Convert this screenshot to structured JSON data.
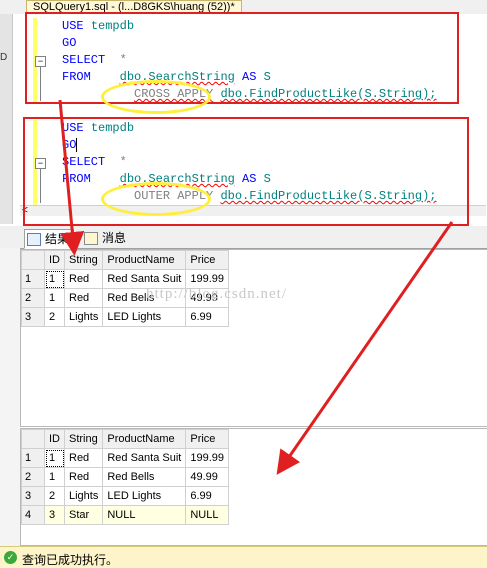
{
  "editor": {
    "tab_title": "SQLQuery1.sql - (l...D8GKS\\huang (52))*",
    "gutter_mark": "D",
    "block1": {
      "line1": {
        "kw": "USE",
        "id": "tempdb"
      },
      "line2": {
        "kw": "GO"
      },
      "line3": {
        "kw": "SELECT",
        "rest": "*"
      },
      "line4": {
        "kw": "FROM",
        "table": "dbo.SearchString",
        "as": "AS",
        "alias": "S"
      },
      "line5": {
        "apply": "CROSS APPLY",
        "func": "dbo.FindProductLike(S.String);"
      }
    },
    "block2": {
      "line1": {
        "kw": "USE",
        "id": "tempdb"
      },
      "line2": {
        "kw": "GO"
      },
      "line3": {
        "kw": "SELECT",
        "rest": "*"
      },
      "line4": {
        "kw": "FROM",
        "table": "dbo.SearchString",
        "as": "AS",
        "alias": "S"
      },
      "line5": {
        "apply": "OUTER APPLY",
        "func": "dbo.FindProductLike(S.String);"
      }
    },
    "scroll_mark": "<"
  },
  "results": {
    "tabs": [
      {
        "label": "结果",
        "icon": "grid-icon"
      },
      {
        "label": "消息",
        "icon": "message-icon"
      }
    ],
    "columns": [
      "",
      "ID",
      "String",
      "ProductName",
      "Price"
    ],
    "grid1": [
      [
        "1",
        "1",
        "Red",
        "Red Santa Suit",
        "199.99"
      ],
      [
        "2",
        "1",
        "Red",
        "Red Bells",
        "49.99"
      ],
      [
        "3",
        "2",
        "Lights",
        "LED Lights",
        "6.99"
      ]
    ],
    "grid2": [
      [
        "1",
        "1",
        "Red",
        "Red Santa Suit",
        "199.99"
      ],
      [
        "2",
        "1",
        "Red",
        "Red Bells",
        "49.99"
      ],
      [
        "3",
        "2",
        "Lights",
        "LED Lights",
        "6.99"
      ],
      [
        "4",
        "3",
        "Star",
        "NULL",
        "NULL"
      ]
    ]
  },
  "watermark": "http://blog.csdn.net/",
  "status": {
    "text": "查询已成功执行。",
    "icon": "success-check-icon"
  },
  "colors": {
    "annotation_red": "#e02020",
    "highlight_yellow": "#ffef3a",
    "keyword_blue": "#0000ff",
    "identifier_teal": "#008080"
  }
}
